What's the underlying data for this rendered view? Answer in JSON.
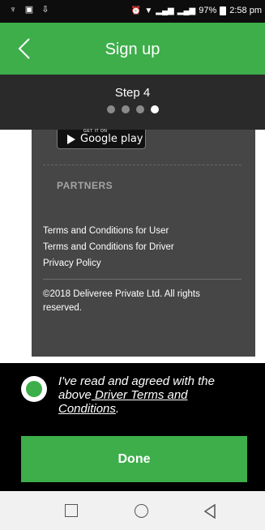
{
  "status_bar": {
    "battery": "97%",
    "time": "2:58 pm"
  },
  "header": {
    "title": "Sign up"
  },
  "step": {
    "label": "Step 4",
    "total": 4,
    "current": 4
  },
  "footer": {
    "store_badge_small": "GET IT ON",
    "store_badge_text": "Google play",
    "partners_heading": "PARTNERS",
    "links": [
      "Terms and Conditions for User",
      "Terms and Conditions for Driver",
      "Privacy Policy"
    ],
    "copyright": "©2018 Deliveree Private Ltd. All rights reserved."
  },
  "agreement": {
    "text_prefix": "I've read and agreed with the above",
    "link_text": " Driver Terms and Conditions",
    "text_suffix": "."
  },
  "done_button": {
    "label": "Done"
  },
  "colors": {
    "brand_green": "#3dae4a",
    "header_dark": "#2a2a2a",
    "footer_gray": "#464646"
  }
}
